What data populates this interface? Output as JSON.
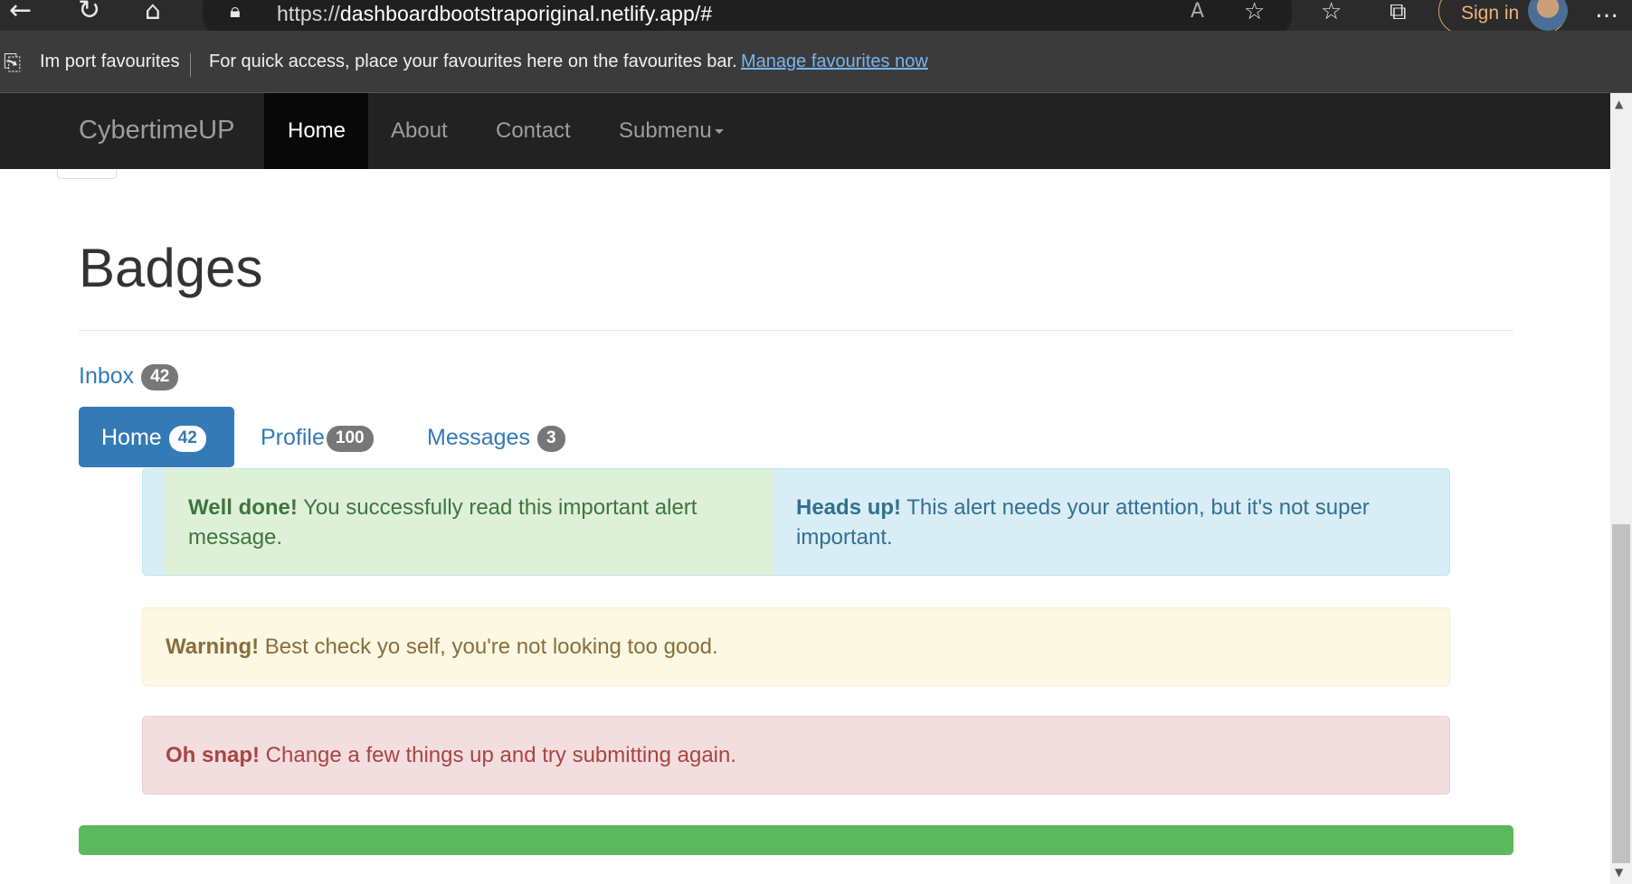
{
  "browser": {
    "url_prefix": "https://",
    "url_host": "dashboardbootstraporiginal.netlify.app/#",
    "sign_in": "Sign in",
    "import_favourites": "Im port favourites",
    "fav_message": "For quick access, place your favourites here on the favourites bar.",
    "fav_link": "Manage favourites now"
  },
  "navbar": {
    "brand": "CybertimeUP",
    "items": [
      {
        "label": "Home",
        "active": true
      },
      {
        "label": "About"
      },
      {
        "label": "Contact"
      },
      {
        "label": "Submenu"
      }
    ]
  },
  "page": {
    "title": "Badges",
    "inbox": {
      "label": "Inbox",
      "count": "42"
    },
    "pills": [
      {
        "label": "Home",
        "count": "42",
        "active": true
      },
      {
        "label": "Profile",
        "count": "100"
      },
      {
        "label": "Messages",
        "count": "3"
      }
    ],
    "alerts": {
      "success": {
        "strong": "Well done!",
        "text": " You successfully read this important alert message."
      },
      "info": {
        "strong": "Heads up!",
        "text": " This alert needs your attention, but it's not super important."
      },
      "warning": {
        "strong": "Warning!",
        "text": " Best check yo self, you're not looking too good."
      },
      "danger": {
        "strong": "Oh snap!",
        "text": " Change a few things up and try submitting again."
      }
    },
    "progress": {
      "value_percent": 100,
      "color": "#5cb85c"
    }
  },
  "colors": {
    "primary": "#337ab7",
    "navbar_bg": "#222222",
    "success_text": "#3c763d",
    "info_text": "#31708f",
    "warning_text": "#8a6d3b",
    "danger_text": "#a94442"
  }
}
